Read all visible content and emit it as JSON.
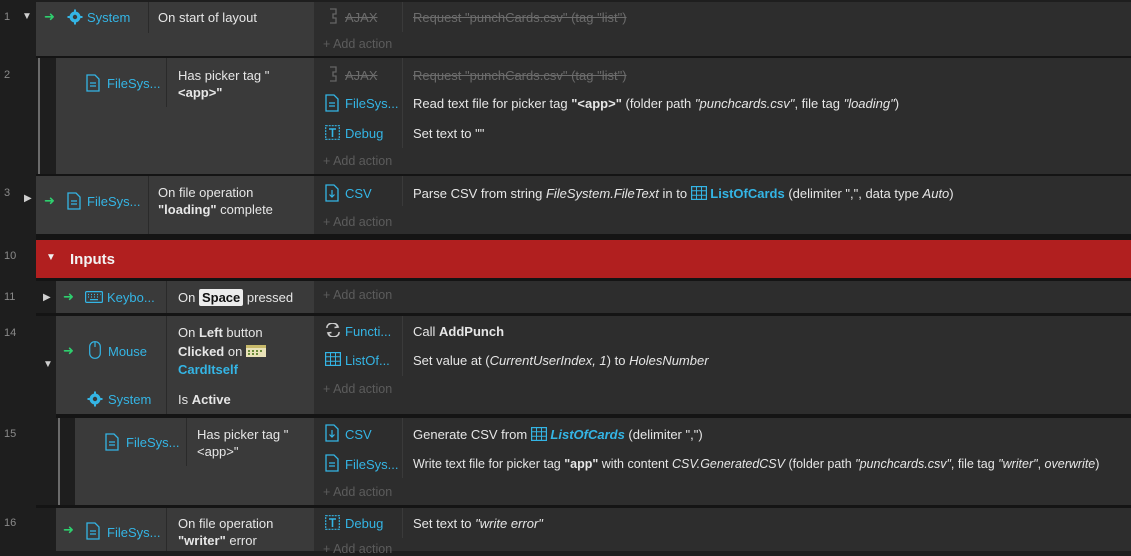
{
  "line_numbers": [
    "1",
    "2",
    "3",
    "10",
    "11",
    "14",
    "15",
    "16"
  ],
  "add_action": "Add action",
  "events": {
    "e1": {
      "cond_object": "System",
      "cond_text": "On start of layout",
      "actions": [
        {
          "object": "AJAX",
          "text": "Request \"punchCards.csv\" (tag \"list\")",
          "disabled": true
        }
      ]
    },
    "e2": {
      "cond_object": "FileSys...",
      "cond_text_1": "Has picker tag \"",
      "cond_text_2": "<app>\"",
      "actions": [
        {
          "object": "AJAX",
          "text": "Request \"punchCards.csv\" (tag \"list\")",
          "disabled": true
        },
        {
          "object": "FileSys...",
          "pre": "Read text file for picker tag ",
          "tag": "\"<app>\"",
          "mid": " (folder path ",
          "path": "\"punchcards.csv\"",
          "mid2": ", file tag ",
          "ftag": "\"loading\"",
          "end": ")"
        },
        {
          "object": "Debug",
          "text": "Set text to \"\""
        }
      ]
    },
    "e3": {
      "cond_object": "FileSys...",
      "cond_text_1": "On file operation",
      "cond_bold": "\"loading\"",
      "cond_text_2": " complete",
      "actions": [
        {
          "object": "CSV",
          "pre": "Parse CSV from string ",
          "expr": "FileSystem.FileText",
          "mid": " in to ",
          "target": "ListOfCards",
          "end_a": " (delimiter \",\", data type ",
          "dtype": "Auto",
          "end_b": ")"
        }
      ]
    },
    "group": {
      "title": "Inputs"
    },
    "e11": {
      "cond_object": "Keybo...",
      "cond_pre": "On ",
      "cond_key": "Space",
      "cond_post": " pressed"
    },
    "e14": {
      "cond1_object": "Mouse",
      "cond1_pre": "On ",
      "cond1_bold": "Left",
      "cond1_mid": " button",
      "cond1_bold2": "Clicked",
      "cond1_on": " on ",
      "cond1_target": "CardItself",
      "cond2_object": "System",
      "cond2_pre": "Is ",
      "cond2_bold": "Active",
      "actions": [
        {
          "object": "Functi...",
          "pre": "Call ",
          "bold": "AddPunch"
        },
        {
          "object": "ListOf...",
          "pre": "Set value at (",
          "expr": "CurrentUserIndex, 1",
          "mid": ") to ",
          "expr2": "HolesNumber"
        }
      ]
    },
    "e15": {
      "cond_object": "FileSys...",
      "cond_text_1": "Has picker tag \"",
      "cond_text_2": "<app>\"",
      "actions": [
        {
          "object": "CSV",
          "pre": "Generate CSV from ",
          "target": "ListOfCards",
          "end": " (delimiter \",\")"
        },
        {
          "object": "FileSys...",
          "pre": "Write text file for picker tag ",
          "tag": "\"app\"",
          "mid": " with content ",
          "expr": "CSV.GeneratedCSV",
          "mid2": " (folder path ",
          "path": "\"punchcards.csv\"",
          "mid3": ", file tag ",
          "ftag": "\"writer\"",
          "mid4": ", ",
          "ow": "overwrite",
          "end": ")"
        }
      ]
    },
    "e16": {
      "cond_object": "FileSys...",
      "cond_text_1": "On file operation",
      "cond_bold": "\"writer\"",
      "cond_text_2": " error",
      "actions": [
        {
          "object": "Debug",
          "pre": "Set text to ",
          "val": "\"write error\""
        }
      ]
    }
  },
  "colors": {
    "group_bar": "#b11f1f",
    "object_text": "#34b5e5",
    "trigger_arrow": "#2ecf6e"
  }
}
